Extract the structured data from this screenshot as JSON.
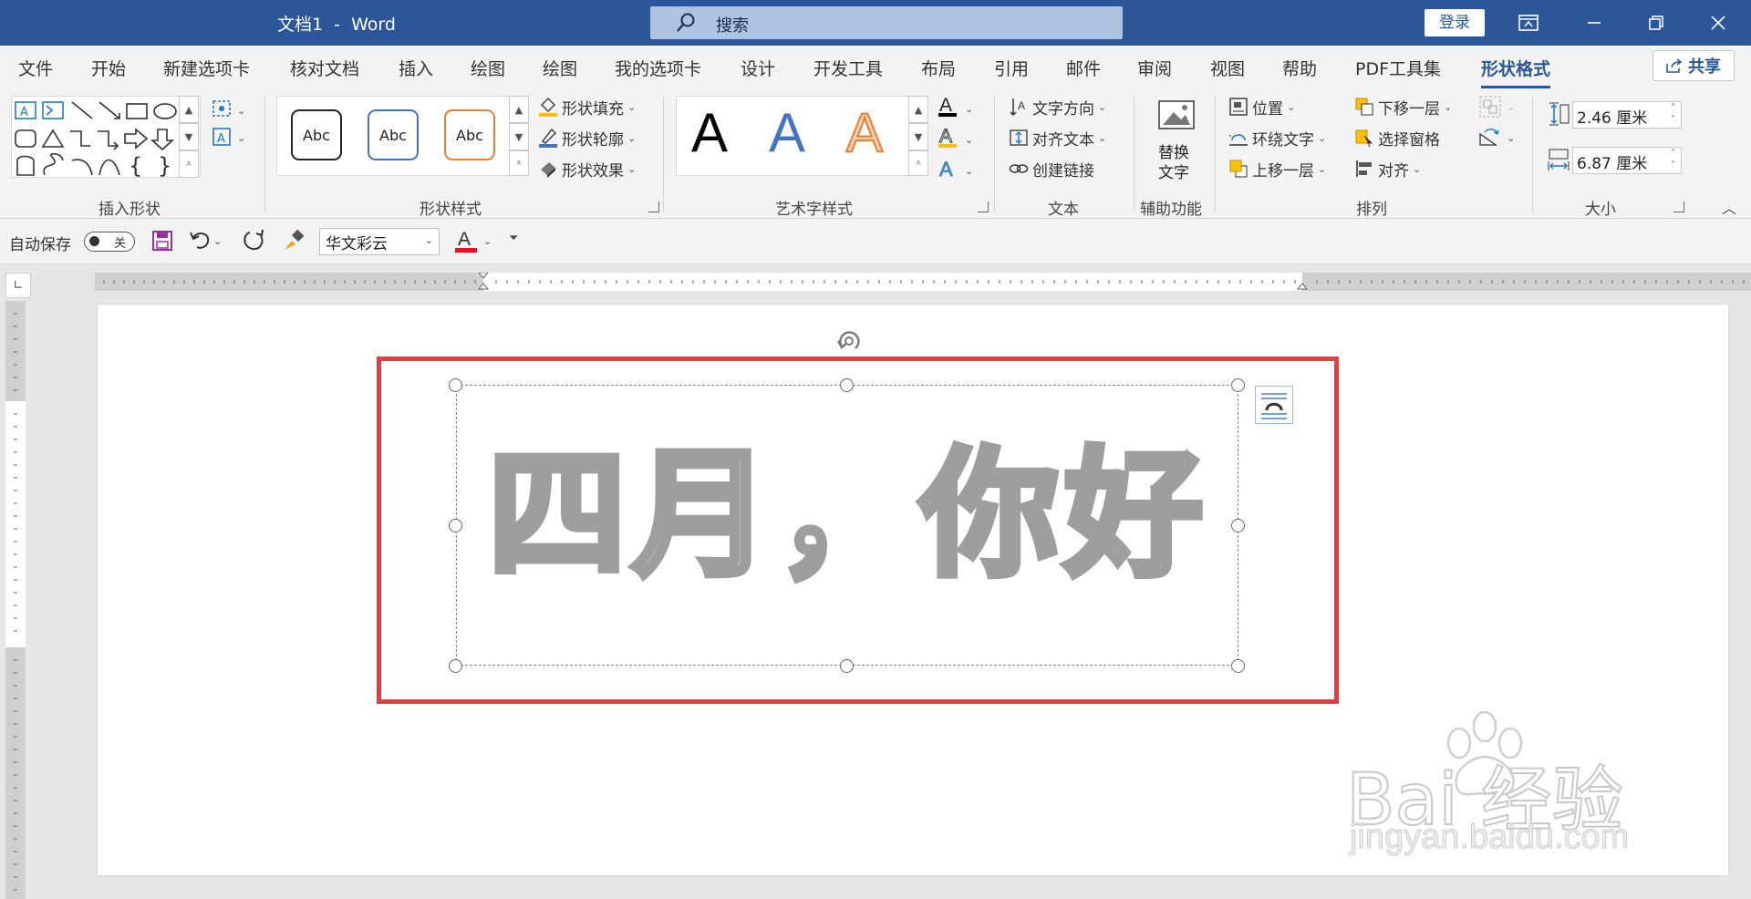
{
  "titlebar": {
    "doc_title": "文档1  -  Word",
    "search_placeholder": "搜索",
    "login_label": "登录",
    "colors": {
      "bar": "#2b579a",
      "search": "#aec3e0"
    }
  },
  "tabs": [
    "文件",
    "开始",
    "新建选项卡",
    "核对文档",
    "插入",
    "绘图",
    "绘图",
    "我的选项卡",
    "设计",
    "开发工具",
    "布局",
    "引用",
    "邮件",
    "审阅",
    "视图",
    "帮助",
    "PDF工具集",
    "形状格式"
  ],
  "active_tab": "形状格式",
  "share_label": "共享",
  "ribbon": {
    "groups": {
      "insert_shapes": "插入形状",
      "shape_styles": "形状样式",
      "wordart_styles": "艺术字样式",
      "text": "文本",
      "accessibility": "辅助功能",
      "arrange": "排列",
      "size": "大小"
    },
    "shape_style_samples": [
      "Abc",
      "Abc",
      "Abc"
    ],
    "shape_fill": "形状填充",
    "shape_outline": "形状轮廓",
    "shape_effects": "形状效果",
    "wordart_samples": [
      "A",
      "A",
      "A"
    ],
    "text_direction": "文字方向",
    "align_text": "对齐文本",
    "create_link": "创建链接",
    "alt_text_line1": "替换",
    "alt_text_line2": "文字",
    "position": "位置",
    "wrap_text": "环绕文字",
    "bring_forward": "上移一层",
    "send_backward": "下移一层",
    "selection_pane": "选择窗格",
    "align": "对齐",
    "height_value": "2.46 厘米",
    "width_value": "6.87 厘米"
  },
  "qat": {
    "autosave_label": "自动保存",
    "autosave_state": "关",
    "font_name": "华文彩云"
  },
  "document": {
    "wordart_text": "四月，你好",
    "highlight_color": "#e8393f"
  },
  "watermark": {
    "brand": "Bai  经验",
    "url": "jingyan.baidu.com"
  }
}
